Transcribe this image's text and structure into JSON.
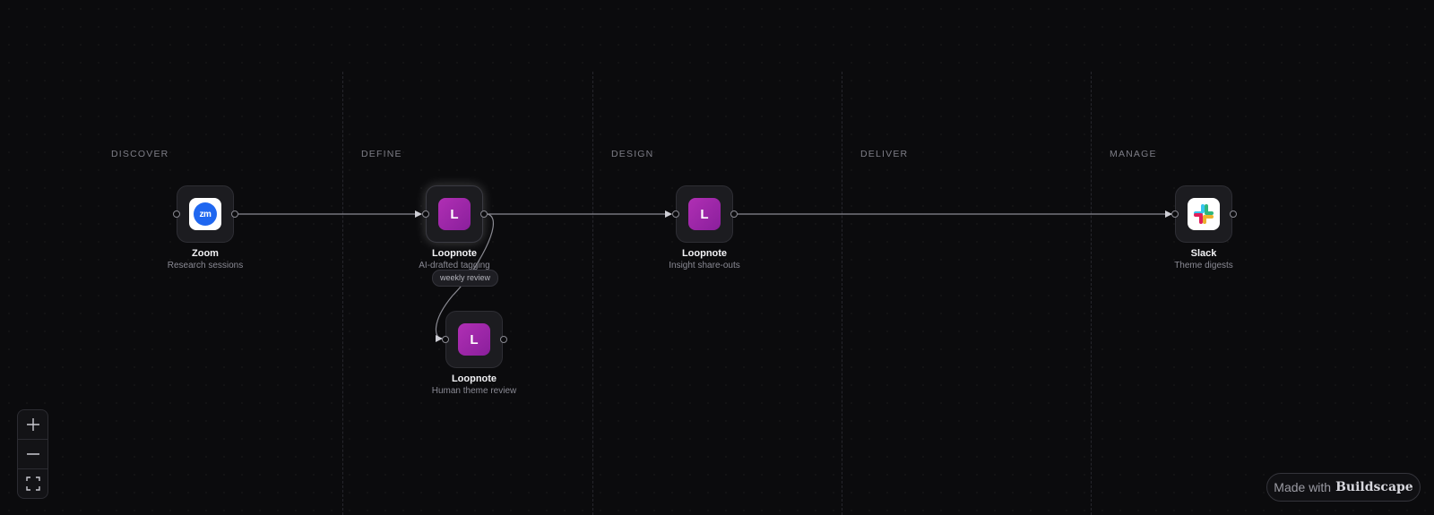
{
  "stages": [
    {
      "label": "DISCOVER"
    },
    {
      "label": "DEFINE"
    },
    {
      "label": "DESIGN"
    },
    {
      "label": "DELIVER"
    },
    {
      "label": "MANAGE"
    }
  ],
  "nodes": [
    {
      "id": "zoom",
      "title": "Zoom",
      "subtitle": "Research sessions",
      "icon": "zoom-logo-icon",
      "icon_text": "zm",
      "icon_color": "#1f67f0"
    },
    {
      "id": "loopnote-tagging",
      "title": "Loopnote",
      "subtitle": "AI-drafted tagging",
      "icon": "loopnote-logo-icon",
      "icon_text": "L",
      "icon_color": "#a428ad",
      "selected": true
    },
    {
      "id": "loopnote-review",
      "title": "Loopnote",
      "subtitle": "Human theme review",
      "icon": "loopnote-logo-icon",
      "icon_text": "L",
      "icon_color": "#a428ad"
    },
    {
      "id": "loopnote-shareouts",
      "title": "Loopnote",
      "subtitle": "Insight share-outs",
      "icon": "loopnote-logo-icon",
      "icon_text": "L",
      "icon_color": "#a428ad"
    },
    {
      "id": "slack",
      "title": "Slack",
      "subtitle": "Theme digests",
      "icon": "slack-logo-icon"
    }
  ],
  "edges": [
    {
      "from": "zoom",
      "to": "loopnote-tagging"
    },
    {
      "from": "loopnote-tagging",
      "to": "loopnote-review",
      "label": "weekly review"
    },
    {
      "from": "loopnote-tagging",
      "to": "loopnote-shareouts"
    },
    {
      "from": "loopnote-shareouts",
      "to": "slack"
    }
  ],
  "controls": {
    "zoom_in": "plus-icon",
    "zoom_out": "minus-icon",
    "fit_view": "fit-view-icon"
  },
  "badge": {
    "prefix": "Made with",
    "brand": "Buildscape"
  },
  "colors": {
    "background": "#0b0b0d",
    "loopnote": "#a428ad",
    "zoom": "#1f67f0"
  }
}
